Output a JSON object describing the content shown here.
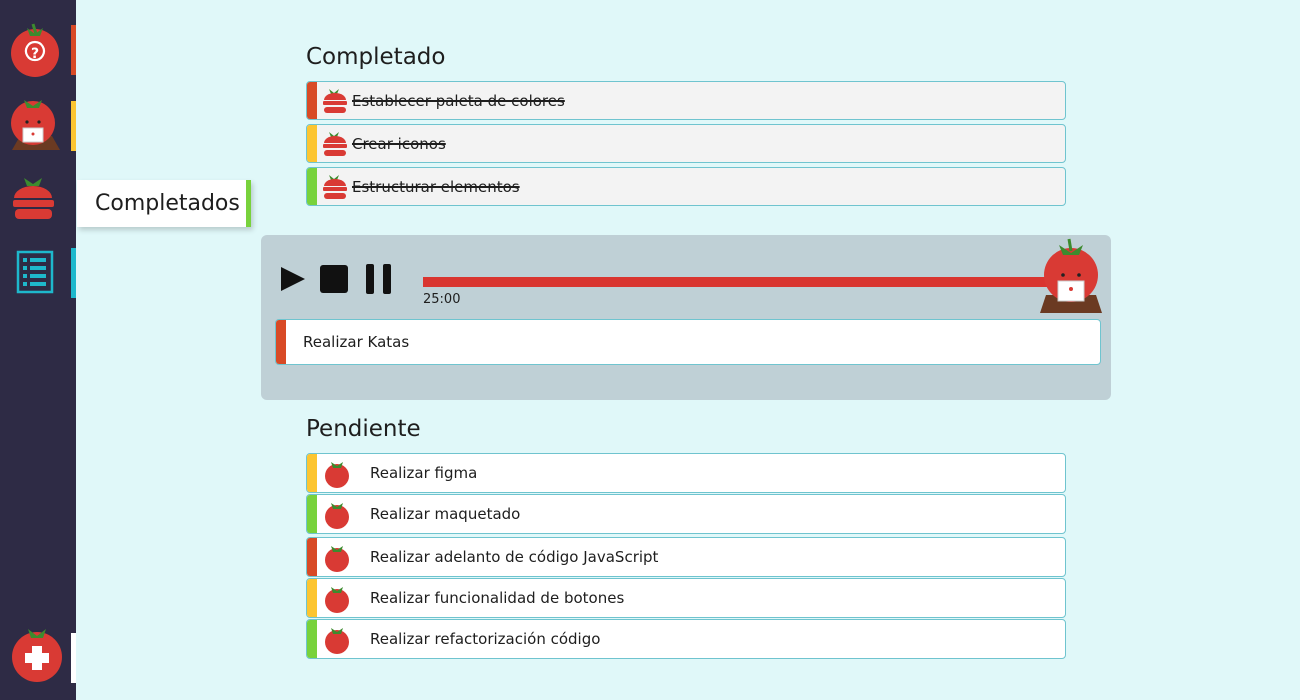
{
  "colors": {
    "sidebar_bg": "#2e2b45",
    "page_bg": "#e0f8f9",
    "red": "#d84a26",
    "yellow": "#fcc531",
    "green": "#78d23c",
    "cyan": "#1eb8cc",
    "tomato": "#d93a34",
    "progress": "#d93530"
  },
  "sidebar": {
    "items": [
      {
        "icon": "help-tomato-icon",
        "accent": "#d84a26"
      },
      {
        "icon": "tomato-laptop-icon",
        "accent": "#fcc531"
      },
      {
        "icon": "completed-stack-icon",
        "accent": "#78d23c"
      },
      {
        "icon": "list-icon",
        "accent": "#1eb8cc"
      }
    ],
    "add_icon": "add-tomato-icon",
    "tooltip": "Completados"
  },
  "completed": {
    "title": "Completado",
    "tasks": [
      {
        "label": "Establecer paleta de colores",
        "color": "#d84a26"
      },
      {
        "label": "Crear iconos",
        "color": "#fcc531"
      },
      {
        "label": "Estructurar elementos",
        "color": "#78d23c"
      }
    ]
  },
  "timer": {
    "time": "25:00",
    "progress": 1.0,
    "controls": [
      "play-icon",
      "stop-icon",
      "pause-icon"
    ],
    "current_task": "Realizar Katas"
  },
  "pending": {
    "title": "Pendiente",
    "tasks": [
      {
        "label": "Realizar figma",
        "color": "#fcc531"
      },
      {
        "label": "Realizar maquetado",
        "color": "#78d23c"
      },
      {
        "label": "Realizar adelanto de código  JavaScript",
        "color": "#d84a26"
      },
      {
        "label": "Realizar funcionalidad de botones",
        "color": "#fcc531"
      },
      {
        "label": "Realizar refactorización código",
        "color": "#78d23c"
      }
    ]
  }
}
